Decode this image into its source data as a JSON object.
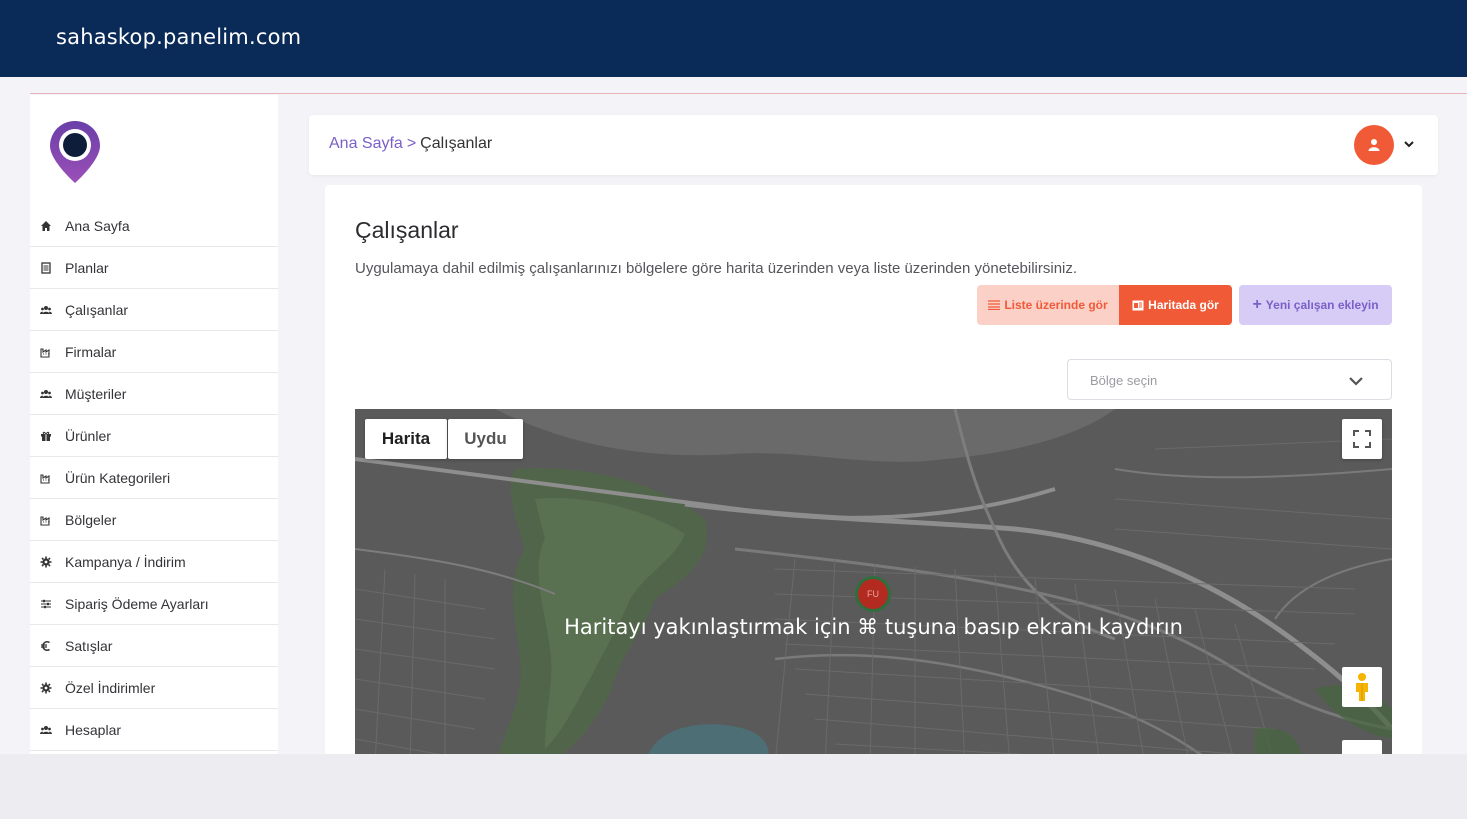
{
  "browser": {
    "domain": "sahaskop.panelim.com"
  },
  "sidebar": {
    "logo_icon": "location-search-logo",
    "items": [
      {
        "label": "Ana Sayfa",
        "icon": "home-icon"
      },
      {
        "label": "Planlar",
        "icon": "document-icon"
      },
      {
        "label": "Çalışanlar",
        "icon": "users-icon"
      },
      {
        "label": "Firmalar",
        "icon": "factory-icon"
      },
      {
        "label": "Müşteriler",
        "icon": "users-icon"
      },
      {
        "label": "Ürünler",
        "icon": "gift-icon"
      },
      {
        "label": "Ürün Kategorileri",
        "icon": "factory-icon"
      },
      {
        "label": "Bölgeler",
        "icon": "factory-icon"
      },
      {
        "label": "Kampanya / İndirim",
        "icon": "gear-icon"
      },
      {
        "label": "Sipariş Ödeme Ayarları",
        "icon": "sliders-icon"
      },
      {
        "label": "Satışlar",
        "icon": "euro-icon"
      },
      {
        "label": "Özel İndirimler",
        "icon": "gear-icon"
      },
      {
        "label": "Hesaplar",
        "icon": "users-icon"
      }
    ]
  },
  "header": {
    "breadcrumb_home": "Ana Sayfa",
    "breadcrumb_sep": ">",
    "breadcrumb_current": "Çalışanlar",
    "avatar_icon": "user-icon",
    "accent": "#f15a36"
  },
  "main": {
    "title": "Çalışanlar",
    "description": "Uygulamaya dahil edilmiş çalışanlarınızı bölgelere göre harita üzerinden veya liste üzerinden yönetebilirsiniz.",
    "buttons": {
      "list_view": "Liste üzerinde gör",
      "map_view": "Haritada gör",
      "new_employee": "Yeni çalışan ekleyin"
    },
    "region_select": {
      "placeholder": "Bölge seçin"
    },
    "map": {
      "type_map": "Harita",
      "type_satellite": "Uydu",
      "marker_label": "FU",
      "overlay_message": "Haritayı yakınlaştırmak için ⌘ tuşuna basıp ekranı kaydırın"
    }
  },
  "colors": {
    "topbar": "#0a2a57",
    "brand_purple": "#7b5fc9",
    "brand_orange": "#f15a36"
  }
}
